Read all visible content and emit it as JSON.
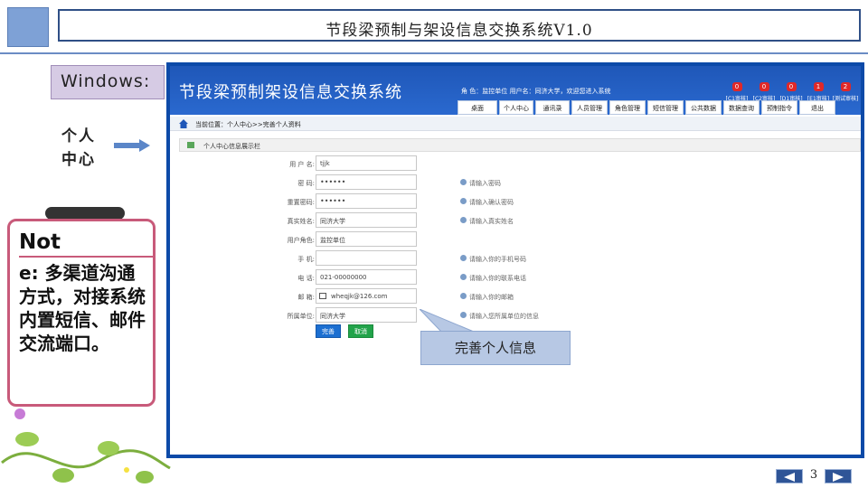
{
  "slide": {
    "title": "节段梁预制与架设信息交换系统V1.0",
    "windows_label": "Windows:",
    "section_label": "个人中心",
    "note_title": "Not",
    "note_body": "e: 多渠道沟通方式，对接系统内置短信、邮件交流端口。",
    "callout": "完善个人信息",
    "page_number": "3"
  },
  "app": {
    "name": "节段梁预制架设信息交换系统",
    "user_info": "角 色：监控单位   用户名：同济大学，欢迎您进入系统",
    "badges": [
      {
        "count": "0",
        "label": "[C1审核]"
      },
      {
        "count": "0",
        "label": "[C2审核]"
      },
      {
        "count": "0",
        "label": "[D1审核]"
      },
      {
        "count": "1",
        "label": "[E1审核]"
      },
      {
        "count": "2",
        "label": "[测试审核]"
      }
    ],
    "nav": [
      "桌面",
      "个人中心",
      "通讯录",
      "人员管理",
      "角色管理",
      "短信管理",
      "公共数据",
      "数据查询",
      "预制指令",
      "退出"
    ],
    "breadcrumb": "当前位置：个人中心>>完善个人资料",
    "panel_title": "个人中心信息展示栏",
    "form": [
      {
        "label": "用 户 名:",
        "value": "tjjk",
        "hint": ""
      },
      {
        "label": "密    码:",
        "value": "••••••",
        "hint": "请输入密码"
      },
      {
        "label": "重置密码:",
        "value": "••••••",
        "hint": "请输入确认密码"
      },
      {
        "label": "真实姓名:",
        "value": "同济大学",
        "hint": "请输入真实姓名"
      },
      {
        "label": "用户角色:",
        "value": "监控单位",
        "hint": ""
      },
      {
        "label": "手    机:",
        "value": "",
        "hint": "请输入你的手机号码"
      },
      {
        "label": "电    话:",
        "value": "021-00000000",
        "hint": "请输入你的联系电话"
      },
      {
        "label": "邮    箱:",
        "value": "wheqjk@126.com",
        "hint": "请输入你的邮箱"
      },
      {
        "label": "所属单位:",
        "value": "同济大学",
        "hint": "请输入您所属单位的信息"
      }
    ],
    "submit_label": "完善",
    "cancel_label": "取消"
  },
  "colors": {
    "accent_blue": "#0d4aa8",
    "submit_blue": "#1c6fd1",
    "cancel_green": "#22a34a",
    "badge_red": "#e02828",
    "note_border": "#c85a7a"
  }
}
